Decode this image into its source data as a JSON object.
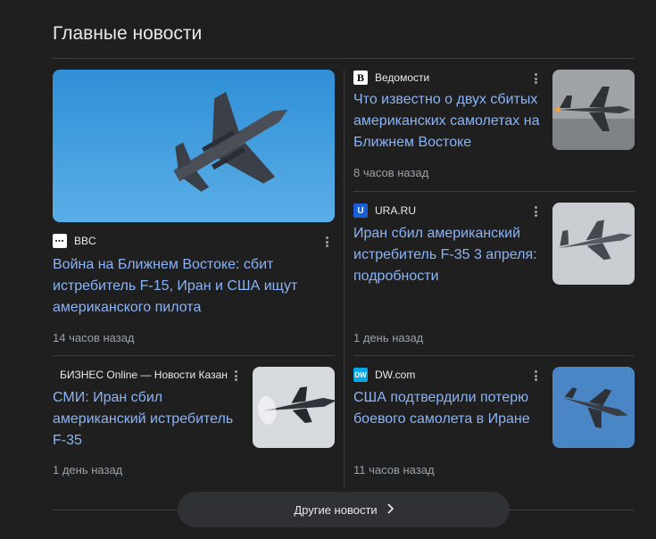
{
  "section": {
    "title": "Главные новости",
    "more_button": "Другие новости"
  },
  "articles": [
    {
      "source": "BBC",
      "title_lines": [
        "Война на Ближнем Востоке: сбит",
        "истребитель F-15, Иран и США ищут",
        "американского пилота"
      ],
      "time": "14 часов назад"
    },
    {
      "source": "Ведомости",
      "title_lines": [
        "Что известно о двух сбитых",
        "американских самолетах на",
        "Ближнем Востоке"
      ],
      "time": "8 часов назад"
    },
    {
      "source": "URA.RU",
      "title_lines": [
        "Иран сбил американский",
        "истребитель F-35 3 апреля:",
        "подробности"
      ],
      "time": "1 день назад"
    },
    {
      "source": "БИЗНЕС Online — Новости Казан",
      "title_lines": [
        "СМИ: Иран сбил",
        "американский истребитель",
        "F-35"
      ],
      "time": "1 день назад"
    },
    {
      "source": "DW.com",
      "title_lines": [
        "США подтвердили потерю",
        "боевого самолета в Иране"
      ],
      "time": "11 часов назад"
    }
  ],
  "icons": {
    "source_bbc": "bbc-logo-icon",
    "source_vedomosti": "vedomosti-logo-icon",
    "source_ura": "ura-logo-icon",
    "source_biznes": "biznes-online-logo-icon",
    "source_dw": "dw-logo-icon",
    "more": "more-vert-icon",
    "chevron": "chevron-right-icon"
  },
  "colors": {
    "background": "#1f1f1f",
    "link": "#8ab4f8",
    "muted": "#9aa0a6",
    "divider": "#3c4043"
  }
}
